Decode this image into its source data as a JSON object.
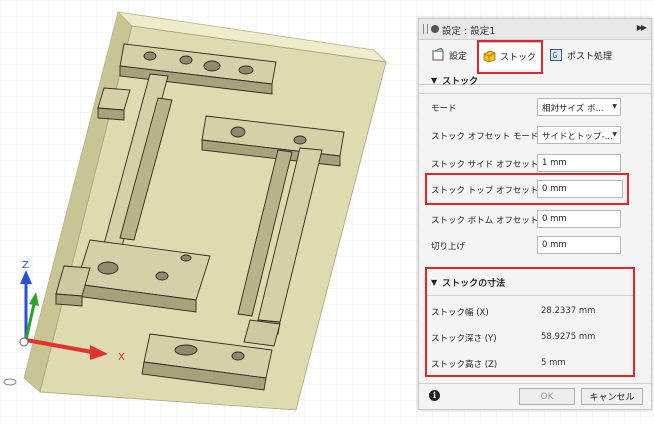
{
  "panel": {
    "title": "設定 : 設定1",
    "tabs": [
      {
        "label": "設定",
        "icon": "tool-settings-icon"
      },
      {
        "label": "ストック",
        "icon": "stock-box-icon"
      },
      {
        "label": "ポスト処理",
        "icon": "post-process-icon"
      }
    ],
    "stock_section": {
      "title": "ストック",
      "rows": [
        {
          "label": "モード",
          "value": "相対サイズ ボ..."
        },
        {
          "label": "ストック オフセット モード",
          "value": "サイドとトップ-..."
        },
        {
          "label": "ストック サイド オフセット",
          "value": "1 mm"
        },
        {
          "label": "ストック トップ オフセット",
          "value": "0 mm"
        },
        {
          "label": "ストック ボトム オフセット",
          "value": "0 mm"
        },
        {
          "label": "切り上げ",
          "value": "0 mm"
        }
      ]
    },
    "dimensions_section": {
      "title": "ストックの寸法",
      "rows": [
        {
          "label": "ストック幅 (X)",
          "value": "28.2337 mm"
        },
        {
          "label": "ストック深さ (Y)",
          "value": "58.9275 mm"
        },
        {
          "label": "ストック高さ (Z)",
          "value": "5 mm"
        }
      ]
    },
    "buttons": {
      "ok": "OK",
      "cancel": "キャンセル"
    },
    "info_glyph": "i"
  },
  "axes": {
    "x": "X",
    "z": "Z"
  },
  "colors": {
    "stock_fill": "#d8d5a2",
    "part_fill": "#c9c39a",
    "highlight": "#e0252f",
    "x_axis": "#e53030",
    "y_axis": "#2aa52a",
    "z_axis": "#2a4fd6"
  }
}
